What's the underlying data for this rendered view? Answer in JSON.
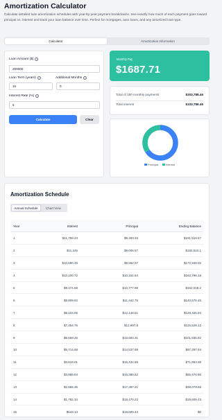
{
  "page": {
    "title": "Amortization Calculator",
    "description": "Calculate detailed loan amortization schedules with year-by-year payment breakdowns. See exactly how much of each payment goes toward principal vs. interest and track your loan balance over time. Perfect for mortgages, auto loans, and any amortized loan type."
  },
  "tabs": [
    {
      "label": "Calculator",
      "active": true
    },
    {
      "label": "Amortization Information",
      "active": false
    }
  ],
  "form": {
    "loan_amount_label": "Loan Amount ($)",
    "loan_amount_value": "200000",
    "loan_term_label": "Loan Term (years)",
    "loan_term_value": "15",
    "additional_months_label": "Additional Months",
    "additional_months_value": "0",
    "interest_rate_label": "Interest Rate (%)",
    "interest_rate_value": "6",
    "calculate_label": "Calculate",
    "clear_label": "Clear"
  },
  "result": {
    "monthly_pay_label": "Monthly Pay",
    "monthly_pay_value": "$1687.71",
    "total_payments_label": "Total of 180 monthly payments",
    "total_payments_value": "$303,788.46",
    "total_interest_label": "Total interest",
    "total_interest_value": "$103,788.46"
  },
  "chart": {
    "principal_fraction": 0.6584,
    "interest_fraction": 0.3416,
    "legend": [
      "Principal",
      "Interest"
    ],
    "colors": {
      "principal": "#3b82f6",
      "interest": "#2dc0a0"
    }
  },
  "schedule": {
    "title": "Amortization Schedule",
    "tabs": [
      "Annual Schedule",
      "Chart View"
    ],
    "columns": [
      "Year",
      "Interest",
      "Principal",
      "Ending Balance"
    ],
    "rows": [
      [
        "1",
        "$11,769.23",
        "$8,483.33",
        "$191,516.67"
      ],
      [
        "2",
        "$11,246",
        "$9,006.57",
        "$182,510.1"
      ],
      [
        "3",
        "$10,690.49",
        "$9,562.07",
        "$172,948.02"
      ],
      [
        "4",
        "$10,100.72",
        "$10,151.84",
        "$162,796.18"
      ],
      [
        "5",
        "$9,474.58",
        "$10,777.98",
        "$152,018.2"
      ],
      [
        "6",
        "$8,809.82",
        "$11,442.75",
        "$140,575.45"
      ],
      [
        "7",
        "$8,104.05",
        "$12,148.51",
        "$128,426.94"
      ],
      [
        "8",
        "$7,354.76",
        "$12,897.8",
        "$115,529.13"
      ],
      [
        "9",
        "$6,559.25",
        "$13,693.31",
        "$101,835.82"
      ],
      [
        "10",
        "$5,714.68",
        "$14,537.89",
        "$87,297.94"
      ],
      [
        "11",
        "$4,818.01",
        "$15,434.55",
        "$71,863.38"
      ],
      [
        "12",
        "$3,866.04",
        "$16,386.52",
        "$55,476.86"
      ],
      [
        "13",
        "$2,855.36",
        "$17,397.21",
        "$38,079.65"
      ],
      [
        "14",
        "$1,782.34",
        "$18,470.23",
        "$19,609.43"
      ],
      [
        "15",
        "$643.13",
        "$19,609.43",
        "$0"
      ]
    ]
  }
}
